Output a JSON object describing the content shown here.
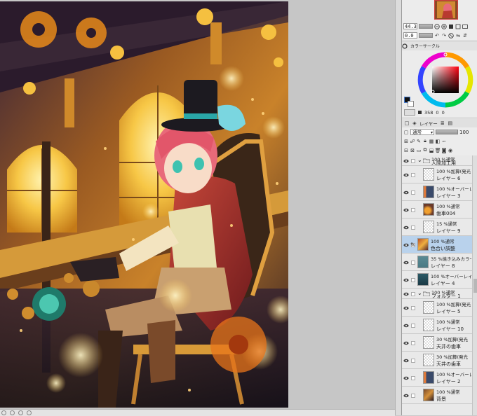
{
  "navigator": {
    "zoom_value": "44.3",
    "rotate_value": "0.0"
  },
  "color": {
    "tab_label": "カラーサークル",
    "h": "358",
    "s": "0",
    "v": "0",
    "main_color": "#101010",
    "sub_color": "#ffffff"
  },
  "layer_panel": {
    "tab_label": "レイヤー",
    "blend_mode": "通常",
    "opacity": "100"
  },
  "layers": [
    {
      "line1": "100 %通常",
      "line2": "人間加工用",
      "type": "folder",
      "indent": 0
    },
    {
      "line1": "100 %加算(発光",
      "line2": "レイヤー 6",
      "type": "layer",
      "indent": 1,
      "thumb": "checker"
    },
    {
      "line1": "100 %オーバーレ",
      "line2": "レイヤー 3",
      "type": "layer",
      "indent": 1,
      "thumb": "art-warm"
    },
    {
      "line1": "100 %通常",
      "line2": "歯車004",
      "type": "layer",
      "indent": 1,
      "thumb": "art-gear"
    },
    {
      "line1": "15 %通常",
      "line2": "レイヤー 9",
      "type": "layer",
      "indent": 1,
      "thumb": "checker"
    },
    {
      "line1": "100 %通常",
      "line2": "色合い調整",
      "type": "layer",
      "indent": 0,
      "thumb": "art-full",
      "selected": true
    },
    {
      "line1": "35 %焼き込みカラー",
      "line2": "レイヤー 8",
      "type": "layer",
      "indent": 0,
      "thumb": "teal"
    },
    {
      "line1": "100 %オーバーレイ",
      "line2": "レイヤー 4",
      "type": "layer",
      "indent": 0,
      "thumb": "teal-dark"
    },
    {
      "line1": "100 %通常",
      "line2": "フォルダー 1",
      "type": "folder",
      "indent": 0
    },
    {
      "line1": "100 %加算(発光",
      "line2": "レイヤー 5",
      "type": "layer",
      "indent": 1,
      "thumb": "checker"
    },
    {
      "line1": "100 %通常",
      "line2": "レイヤー 10",
      "type": "layer",
      "indent": 1,
      "thumb": "checker"
    },
    {
      "line1": "30 %加算(発光",
      "line2": "天井の歯車",
      "type": "layer",
      "indent": 1,
      "thumb": "checker"
    },
    {
      "line1": "30 %加算(発光",
      "line2": "天井の歯車",
      "type": "layer",
      "indent": 1,
      "thumb": "checker"
    },
    {
      "line1": "100 %オーバーレ",
      "line2": "レイヤー 2",
      "type": "layer",
      "indent": 1,
      "thumb": "art-warm"
    },
    {
      "line1": "100 %通常",
      "line2": "背景",
      "type": "layer",
      "indent": 1,
      "thumb": "art-dark"
    }
  ]
}
